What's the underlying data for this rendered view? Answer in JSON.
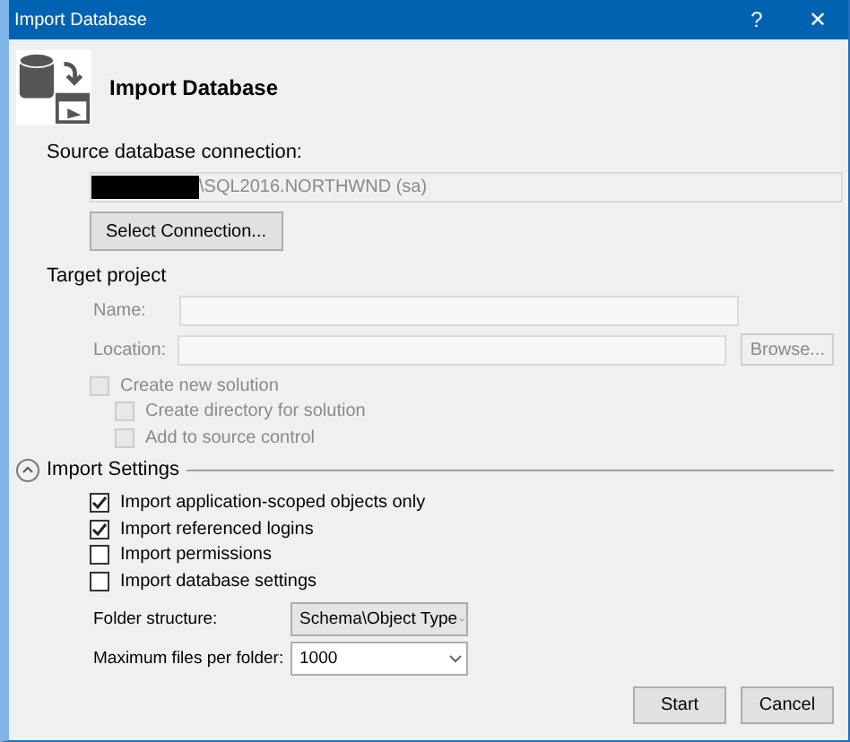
{
  "window": {
    "title": "Import Database",
    "help": "?",
    "close": "✕"
  },
  "header": {
    "title": "Import Database"
  },
  "source": {
    "label": "Source database connection:",
    "connection": "\\SQL2016.NORTHWND (sa)",
    "redacted": true,
    "button": "Select Connection..."
  },
  "target": {
    "heading": "Target project",
    "fields": [
      {
        "label": "Name:",
        "disabled": true
      },
      {
        "label": "Location:",
        "disabled": true,
        "button": "Browse..."
      }
    ],
    "options": [
      {
        "label": "Create new solution",
        "checked": false,
        "disabled": true,
        "children": [
          {
            "label": "Create directory for solution",
            "checked": false,
            "disabled": true
          },
          {
            "label": "Add to source control",
            "checked": false,
            "disabled": true
          }
        ]
      }
    ]
  },
  "import_settings": {
    "heading": "Import Settings",
    "expanded": true,
    "options": [
      {
        "label": "Import application-scoped objects only",
        "checked": true
      },
      {
        "label": "Import referenced logins",
        "checked": true
      },
      {
        "label": "Import permissions",
        "checked": false
      },
      {
        "label": "Import database settings",
        "checked": false
      }
    ],
    "dropdowns": [
      {
        "label": "Folder structure:",
        "value": "Schema\\Object Type"
      },
      {
        "label": "Maximum files per folder:",
        "value": "1000"
      }
    ]
  },
  "buttons": [
    "Start",
    "Cancel"
  ]
}
